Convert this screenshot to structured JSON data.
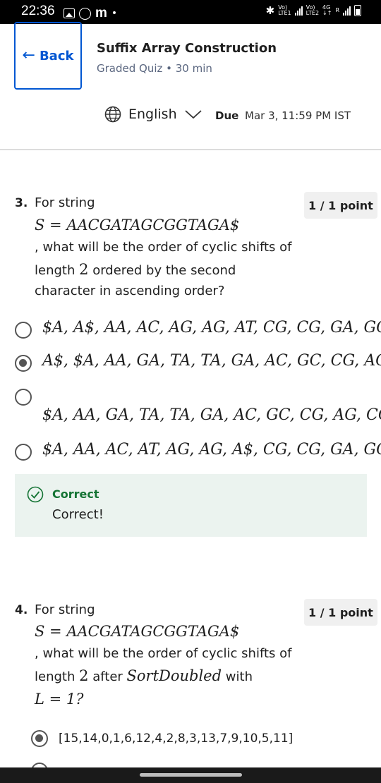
{
  "status_bar": {
    "time": "22:36",
    "app_letter": "m",
    "dot": "•",
    "net1": "Vo)",
    "net1_sub": "LTE1",
    "net2": "Vo)",
    "net2_sub": "LTE2",
    "net_type": "4G",
    "roaming": "R"
  },
  "header": {
    "back_label": "Back",
    "title": "Suffix Array Construction",
    "subtitle": "Graded Quiz • 30 min",
    "language": "English",
    "due_label": "Due",
    "due_value": "Mar 3, 11:59 PM IST"
  },
  "questions": [
    {
      "number": "3.",
      "line1": "For string",
      "math1": "S = AACGATAGCGGTAGA$",
      "line2": ", what will be the order of cyclic shifts of",
      "line3_pre": "length ",
      "line3_num": "2",
      "line3_post": " ordered by the second",
      "line4": "character in ascending order?",
      "points": "1 / 1 point",
      "options": [
        {
          "text": "$A, A$, AA, AC, AG, AG, AT, CG, CG, GA, GC, TA, TA",
          "selected": false
        },
        {
          "text": "A$, $A, AA, GA, TA, TA, GA, AC, GC, CG, AG, CG, AT",
          "selected": true
        },
        {
          "text": "$A, AA, GA, TA, TA, GA, AC, GC, CG, AG, CG, AT, A$",
          "selected": false
        },
        {
          "text": "$A, AA, AC, AT, AG, AG, A$, CG, CG, GA, GC, TA, TA",
          "selected": false
        }
      ],
      "feedback": {
        "title": "Correct",
        "text": "Correct!"
      }
    },
    {
      "number": "4.",
      "line1": "For string",
      "math1": "S = AACGATAGCGGTAGA$",
      "line2": ", what will be the order of cyclic shifts of",
      "line3_pre": "length ",
      "line3_num": "2",
      "line3_mid": " after ",
      "line3_math": "SortDoubled",
      "line3_post": " with",
      "line4_math": "L = 1?",
      "points": "1 / 1 point",
      "options": [
        {
          "text": "[15,14,0,1,6,12,4,2,8,3,13,7,9,10,5,11]",
          "selected": true
        }
      ]
    }
  ],
  "colors": {
    "accent": "#0056d2",
    "correct_green": "#137333",
    "feedback_bg": "#ebf3ef",
    "badge_bg": "#f0f0f0"
  },
  "icons": {
    "back": "arrow-left-icon",
    "language": "globe-icon",
    "dropdown": "chevron-down-icon",
    "correct": "check-circle-icon"
  }
}
